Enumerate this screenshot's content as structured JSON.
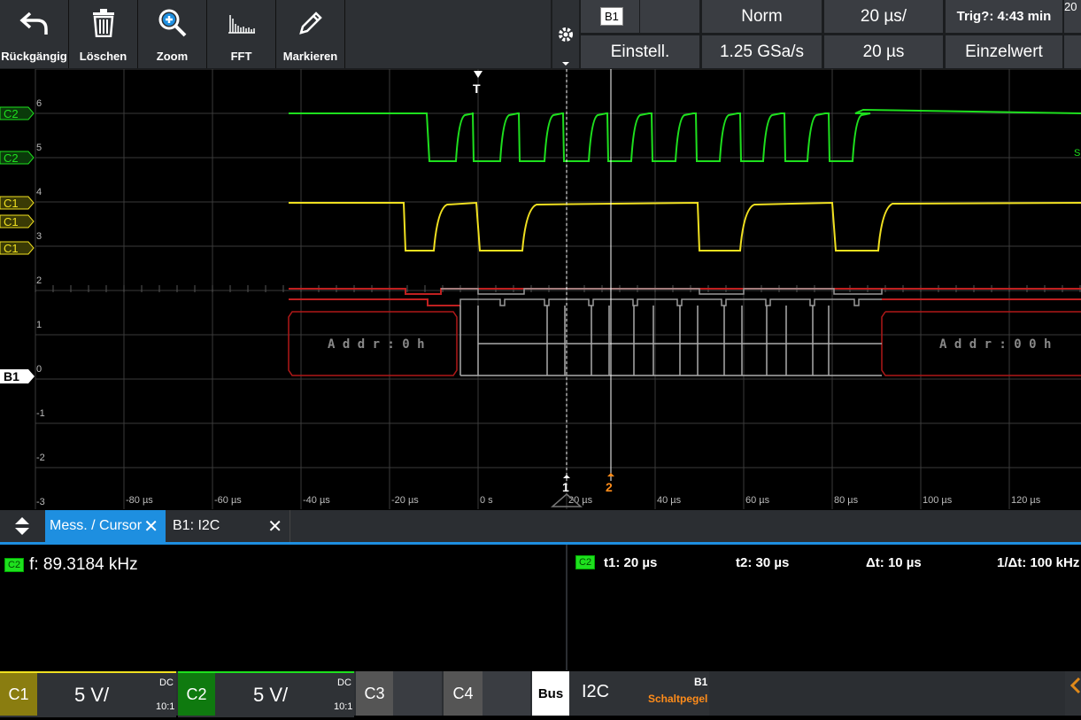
{
  "toolbar": {
    "buttons": [
      {
        "label": "Rückgängig",
        "icon": "undo-icon"
      },
      {
        "label": "Löschen",
        "icon": "trash-icon"
      },
      {
        "label": "Zoom",
        "icon": "zoom-icon"
      },
      {
        "label": "FFT",
        "icon": "fft-icon"
      },
      {
        "label": "Markieren",
        "icon": "pen-icon"
      }
    ],
    "source_badge": "B1",
    "trigger_mode": "Norm",
    "time_div": "20 µs/",
    "trig_status": "Trig?: 4:43 min",
    "settings": "Einstell.",
    "sample_rate": "1.25 GSa/s",
    "time_pos": "20 µs",
    "acq_mode": "Einzelwert",
    "corner_text": "20"
  },
  "plot": {
    "y_ticks": [
      "6",
      "5",
      "4",
      "3",
      "2",
      "1",
      "0",
      "-1",
      "-2",
      "-3"
    ],
    "x_ticks": [
      "-80 µs",
      "-60 µs",
      "-40 µs",
      "-20 µs",
      "0 s",
      "20 µs",
      "40 µs",
      "60 µs",
      "80 µs",
      "100 µs",
      "120 µs"
    ],
    "labels": {
      "c2_trig": "C2",
      "c2": "C2",
      "c1_trig": "C1",
      "c1_level": "C1",
      "c1": "C1",
      "b1": "B1"
    },
    "decode_left": "A d d r : 0 h",
    "decode_right": "A d d r : 0 0 h",
    "trigger_marker": "T",
    "cursor1": "1",
    "cursor2": "2",
    "edge_label": "S",
    "colors": {
      "c1": "#f0e020",
      "c2": "#1ee01e",
      "bus": "#cc2020",
      "cursor2": "#ff8c1a"
    }
  },
  "tabs": [
    {
      "label": "Mess. / Cursor",
      "active": true
    },
    {
      "label": "B1: I2C",
      "active": false
    }
  ],
  "measure": {
    "badge": "C2",
    "freq": "f: 89.3184 kHz"
  },
  "cursor": {
    "badge": "C2",
    "t1": "t1: 20 µs",
    "t2": "t2: 30 µs",
    "dt": "Δt: 10 µs",
    "inv_dt": "1/Δt: 100 kHz"
  },
  "bottom": {
    "c1": {
      "name": "C1",
      "scale": "5 V/",
      "coupling": "DC",
      "probe": "10:1",
      "color": "#f0e020"
    },
    "c2": {
      "name": "C2",
      "scale": "5 V/",
      "coupling": "DC",
      "probe": "10:1",
      "color": "#1ee01e"
    },
    "c3": {
      "name": "C3"
    },
    "c4": {
      "name": "C4"
    },
    "bus": {
      "name": "Bus",
      "proto": "I2C",
      "id": "B1",
      "mode": "Schaltpegel"
    }
  }
}
